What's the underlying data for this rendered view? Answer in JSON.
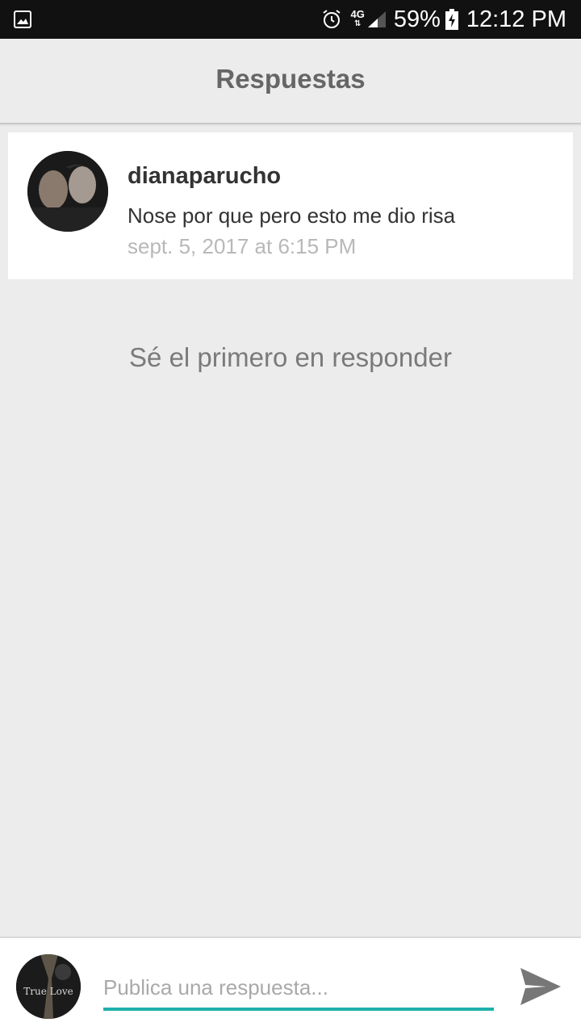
{
  "status_bar": {
    "network": "4G",
    "battery_percent": "59%",
    "time": "12:12 PM",
    "icons": [
      "gallery-icon",
      "alarm-icon",
      "signal-icon",
      "battery-charging-icon"
    ]
  },
  "header": {
    "title": "Respuestas"
  },
  "reply": {
    "username": "dianaparucho",
    "message": "Nose por que pero esto me dio risa",
    "timestamp": "sept. 5, 2017 at 6:15 PM"
  },
  "empty_state": "Sé el primero en responder",
  "composer": {
    "placeholder": "Publica una respuesta...",
    "avatar_text": "True Love",
    "send_icon": "send-icon"
  },
  "colors": {
    "accent": "#1fb0ad",
    "background": "#ececec",
    "status_bar": "#111111"
  }
}
